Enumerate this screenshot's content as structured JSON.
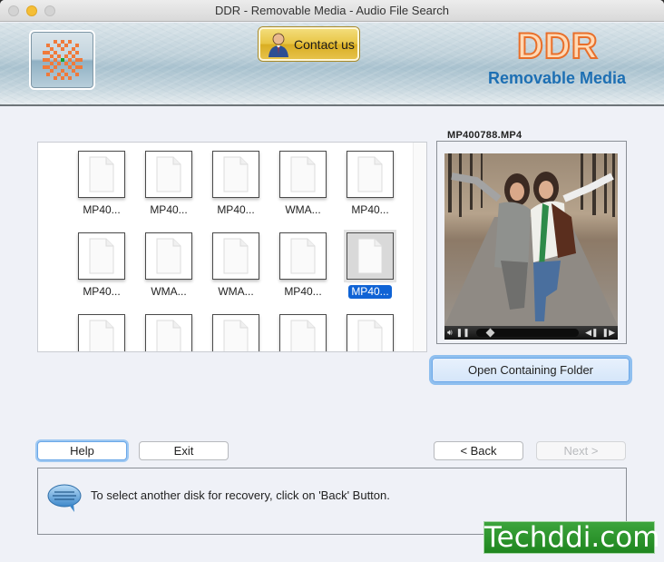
{
  "window": {
    "title": "DDR - Removable Media - Audio File Search"
  },
  "banner": {
    "contact_label": "Contact us",
    "brand_name": "DDR",
    "brand_subtitle": "Removable Media"
  },
  "files": {
    "items": [
      {
        "label": "MP40...",
        "selected": false
      },
      {
        "label": "MP40...",
        "selected": false
      },
      {
        "label": "MP40...",
        "selected": false
      },
      {
        "label": "WMA...",
        "selected": false
      },
      {
        "label": "MP40...",
        "selected": false
      },
      {
        "label": "MP40...",
        "selected": false
      },
      {
        "label": "WMA...",
        "selected": false
      },
      {
        "label": "WMA...",
        "selected": false
      },
      {
        "label": "MP40...",
        "selected": false
      },
      {
        "label": "MP40...",
        "selected": true
      },
      {
        "label": "",
        "selected": false
      },
      {
        "label": "",
        "selected": false
      },
      {
        "label": "",
        "selected": false
      },
      {
        "label": "",
        "selected": false
      },
      {
        "label": "",
        "selected": false
      }
    ]
  },
  "preview": {
    "title": "MP400788.MP4",
    "seek_position_fraction": 0.12,
    "open_folder_label": "Open Containing Folder"
  },
  "buttons": {
    "help": "Help",
    "exit": "Exit",
    "back": "< Back",
    "next": "Next >"
  },
  "info": {
    "message": "To select another disk for recovery, click on 'Back' Button."
  },
  "watermark": {
    "text": "Techddi.com"
  },
  "colors": {
    "accent_blue": "#0f63d5",
    "brand_orange": "#e86f2a",
    "brand_blue": "#1d6fb3",
    "watermark_green": "#2a932a"
  }
}
